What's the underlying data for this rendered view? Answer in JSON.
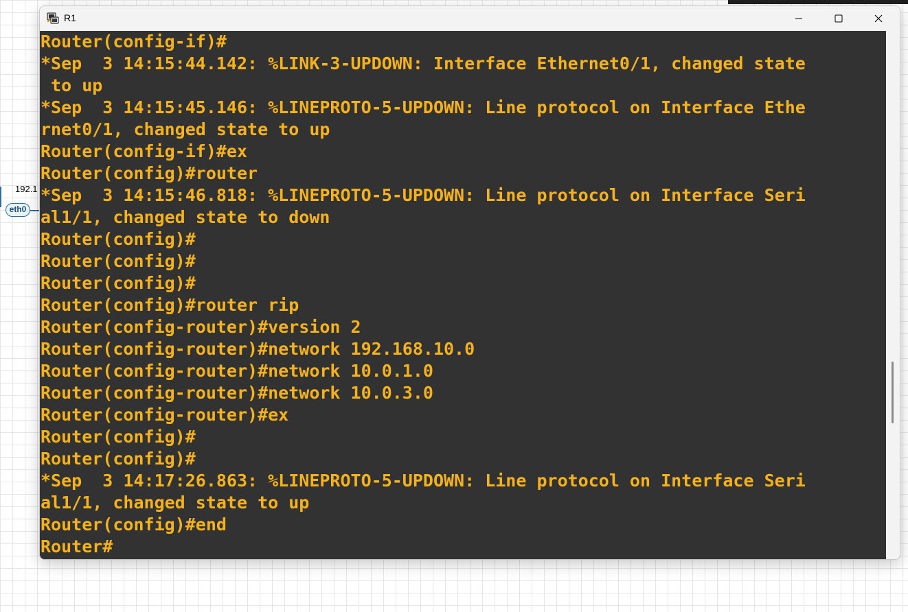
{
  "background": {
    "node_ip_label": "192.1",
    "interface_label": "eth0"
  },
  "window": {
    "title": "R1",
    "icon": "terminal-app-icon",
    "controls": {
      "minimize_icon": "minimize-icon",
      "maximize_icon": "maximize-icon",
      "close_icon": "close-icon"
    }
  },
  "terminal": {
    "text_color": "#f5b21c",
    "background_color": "#323232",
    "lines": [
      "Router(config-if)#",
      "*Sep  3 14:15:44.142: %LINK-3-UPDOWN: Interface Ethernet0/1, changed state",
      " to up",
      "*Sep  3 14:15:45.146: %LINEPROTO-5-UPDOWN: Line protocol on Interface Ethe",
      "rnet0/1, changed state to up",
      "Router(config-if)#ex",
      "Router(config)#router",
      "*Sep  3 14:15:46.818: %LINEPROTO-5-UPDOWN: Line protocol on Interface Seri",
      "al1/1, changed state to down",
      "Router(config)#",
      "Router(config)#",
      "Router(config)#",
      "Router(config)#router rip",
      "Router(config-router)#version 2",
      "Router(config-router)#network 192.168.10.0",
      "Router(config-router)#network 10.0.1.0",
      "Router(config-router)#network 10.0.3.0",
      "Router(config-router)#ex",
      "Router(config)#",
      "Router(config)#",
      "*Sep  3 14:17:26.863: %LINEPROTO-5-UPDOWN: Line protocol on Interface Seri",
      "al1/1, changed state to up",
      "Router(config)#end",
      "Router#"
    ]
  }
}
